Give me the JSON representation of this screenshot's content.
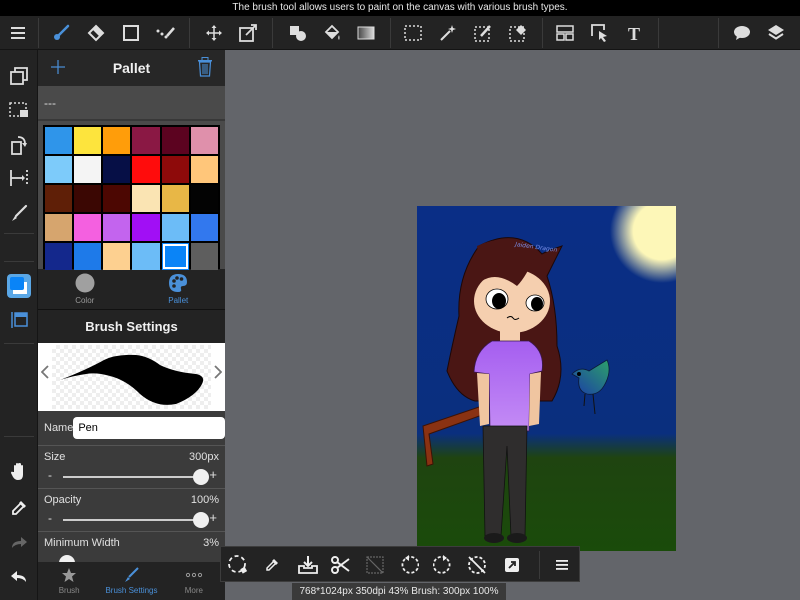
{
  "tooltip": "The brush tool allows users to paint on the canvas with various brush types.",
  "toolbar": {
    "items": [
      {
        "name": "menu",
        "active": false
      },
      {
        "name": "brush",
        "active": true
      },
      {
        "name": "eraser",
        "active": false
      },
      {
        "name": "shape",
        "active": false
      },
      {
        "name": "dot-line",
        "active": false
      },
      {
        "name": "move",
        "active": false
      },
      {
        "name": "transform",
        "active": false
      },
      {
        "name": "fill-shapes",
        "active": false
      },
      {
        "name": "bucket",
        "active": false
      },
      {
        "name": "gradient",
        "active": false
      },
      {
        "name": "select-rect",
        "active": false
      },
      {
        "name": "magic-wand",
        "active": false
      },
      {
        "name": "select-pen",
        "active": false
      },
      {
        "name": "select-eraser",
        "active": false
      },
      {
        "name": "frame-divider",
        "active": false
      },
      {
        "name": "operation",
        "active": false
      },
      {
        "name": "text",
        "active": false
      },
      {
        "name": "speech-bubble",
        "active": false
      },
      {
        "name": "layers",
        "active": false
      }
    ]
  },
  "pallet": {
    "title": "Pallet",
    "name": "---",
    "colors": [
      "#2f95ea",
      "#fde43d",
      "#ff9d0a",
      "#8a1844",
      "#5c0320",
      "#df90ab",
      "#7dcbfa",
      "#f4f4f4",
      "#060f46",
      "#ff0c0c",
      "#8e0a0a",
      "#ffc67a",
      "#5f1f07",
      "#3b0703",
      "#4c0702",
      "#fae4b3",
      "#e8b746",
      "#030303",
      "#d6a56e",
      "#f460e0",
      "#c364ee",
      "#a10ff5",
      "#6cbcf7",
      "#3278ee",
      "#14288c",
      "#1e7ae9",
      "#fdd090",
      "#6cbcf7",
      "#0a84f7",
      "#5e5e5e"
    ],
    "selected_index": 28
  },
  "mode_tabs": {
    "color_label": "Color",
    "pallet_label": "Pallet",
    "active": "pallet"
  },
  "brush_settings": {
    "title": "Brush Settings",
    "name_label": "Name",
    "name_value": "Pen",
    "size": {
      "label": "Size",
      "value": "300px",
      "fraction": 1.0
    },
    "opacity": {
      "label": "Opacity",
      "value": "100%",
      "fraction": 1.0
    },
    "min_width": {
      "label": "Minimum Width",
      "value": "3%",
      "fraction": 0.03
    },
    "minus": "-",
    "plus": "+"
  },
  "bottom_tabs": {
    "brush": "Brush",
    "brush_settings": "Brush Settings",
    "more": "More",
    "active": "brush_settings"
  },
  "canvas_art": {
    "signature": "Jaiden Dragon"
  },
  "status_bar": "768*1024px 350dpi 43% Brush: 300px 100%",
  "colors": {
    "accent": "#4a90d9",
    "panel_bg": "#2a2a2a",
    "workspace_bg": "#63656a"
  }
}
